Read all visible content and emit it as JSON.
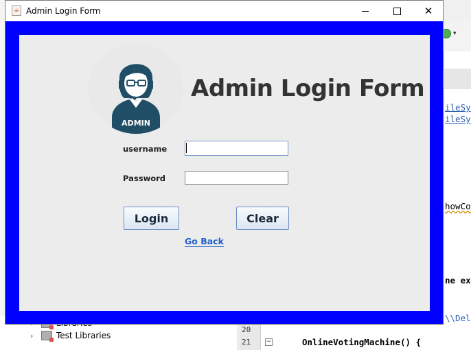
{
  "window": {
    "title": "Admin Login Form",
    "icon": "java-cup-icon"
  },
  "form": {
    "heading": "Admin Login Form",
    "avatar_badge": "ADMIN",
    "username_label": "username",
    "username_value": "",
    "password_label": "Password",
    "password_value": "",
    "login_label": "Login",
    "clear_label": "Clear",
    "go_back_label": "Go Back"
  },
  "colors": {
    "frame": "#0000ff",
    "panel": "#ececec",
    "link": "#2060c8",
    "avatar": "#1f4e66"
  },
  "ide": {
    "code_lines": [
      "ileSy",
      "ileSy",
      "howCor",
      "ne ex",
      "\\\\Del"
    ],
    "code_line_21": "OnlineVotingMachine() {",
    "line_numbers": [
      "20",
      "21"
    ],
    "tree_items": [
      "Libraries",
      "Test Libraries"
    ]
  }
}
